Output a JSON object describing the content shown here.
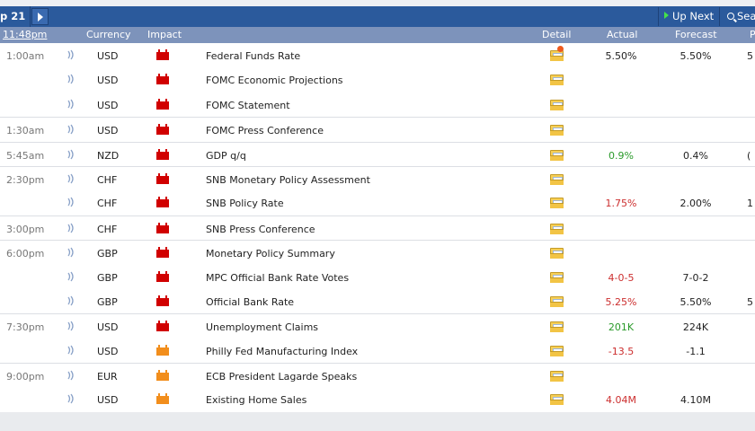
{
  "toolbar": {
    "date_label": "p 21",
    "up_next_label": "Up Next",
    "search_label": "Sea"
  },
  "columns": {
    "time": "11:48pm",
    "currency": "Currency",
    "impact": "Impact",
    "detail": "Detail",
    "actual": "Actual",
    "forecast": "Forecast",
    "previous": "P"
  },
  "colors": {
    "toolbar": "#2b5a9c",
    "header": "#7d93bb",
    "high_impact": "#d10000",
    "medium_impact": "#f28e1c",
    "better": "#2a9a2a",
    "worse": "#cc2e2e"
  },
  "events": [
    {
      "time": "1:00am",
      "currency": "USD",
      "impact": "high",
      "event": "Federal Funds Rate",
      "actual": "5.50%",
      "actual_color": "",
      "forecast": "5.50%",
      "previous": "5",
      "detail_icon": "folder-star-icon"
    },
    {
      "time": "",
      "currency": "USD",
      "impact": "high",
      "event": "FOMC Economic Projections",
      "actual": "",
      "actual_color": "",
      "forecast": "",
      "previous": "",
      "detail_icon": "folder-icon"
    },
    {
      "time": "",
      "currency": "USD",
      "impact": "high",
      "event": "FOMC Statement",
      "actual": "",
      "actual_color": "",
      "forecast": "",
      "previous": "",
      "detail_icon": "folder-icon"
    },
    {
      "time": "1:30am",
      "currency": "USD",
      "impact": "high",
      "event": "FOMC Press Conference",
      "actual": "",
      "actual_color": "",
      "forecast": "",
      "previous": "",
      "detail_icon": "folder-icon"
    },
    {
      "time": "5:45am",
      "currency": "NZD",
      "impact": "high",
      "event": "GDP q/q",
      "actual": "0.9%",
      "actual_color": "green",
      "forecast": "0.4%",
      "previous": "(",
      "detail_icon": "folder-icon"
    },
    {
      "time": "2:30pm",
      "currency": "CHF",
      "impact": "high",
      "event": "SNB Monetary Policy Assessment",
      "actual": "",
      "actual_color": "",
      "forecast": "",
      "previous": "",
      "detail_icon": "folder-icon"
    },
    {
      "time": "",
      "currency": "CHF",
      "impact": "high",
      "event": "SNB Policy Rate",
      "actual": "1.75%",
      "actual_color": "red",
      "forecast": "2.00%",
      "previous": "1",
      "detail_icon": "folder-icon"
    },
    {
      "time": "3:00pm",
      "currency": "CHF",
      "impact": "high",
      "event": "SNB Press Conference",
      "actual": "",
      "actual_color": "",
      "forecast": "",
      "previous": "",
      "detail_icon": "folder-icon"
    },
    {
      "time": "6:00pm",
      "currency": "GBP",
      "impact": "high",
      "event": "Monetary Policy Summary",
      "actual": "",
      "actual_color": "",
      "forecast": "",
      "previous": "",
      "detail_icon": "folder-icon"
    },
    {
      "time": "",
      "currency": "GBP",
      "impact": "high",
      "event": "MPC Official Bank Rate Votes",
      "actual": "4-0-5",
      "actual_color": "red",
      "forecast": "7-0-2",
      "previous": "",
      "detail_icon": "folder-icon"
    },
    {
      "time": "",
      "currency": "GBP",
      "impact": "high",
      "event": "Official Bank Rate",
      "actual": "5.25%",
      "actual_color": "red",
      "forecast": "5.50%",
      "previous": "5",
      "detail_icon": "folder-icon"
    },
    {
      "time": "7:30pm",
      "currency": "USD",
      "impact": "high",
      "event": "Unemployment Claims",
      "actual": "201K",
      "actual_color": "green",
      "forecast": "224K",
      "previous": "",
      "detail_icon": "folder-icon"
    },
    {
      "time": "",
      "currency": "USD",
      "impact": "medium",
      "event": "Philly Fed Manufacturing Index",
      "actual": "-13.5",
      "actual_color": "red",
      "forecast": "-1.1",
      "previous": "",
      "detail_icon": "folder-icon"
    },
    {
      "time": "9:00pm",
      "currency": "EUR",
      "impact": "medium",
      "event": "ECB President Lagarde Speaks",
      "actual": "",
      "actual_color": "",
      "forecast": "",
      "previous": "",
      "detail_icon": "folder-icon"
    },
    {
      "time": "",
      "currency": "USD",
      "impact": "medium",
      "event": "Existing Home Sales",
      "actual": "4.04M",
      "actual_color": "red",
      "forecast": "4.10M",
      "previous": "",
      "detail_icon": "folder-icon"
    }
  ]
}
